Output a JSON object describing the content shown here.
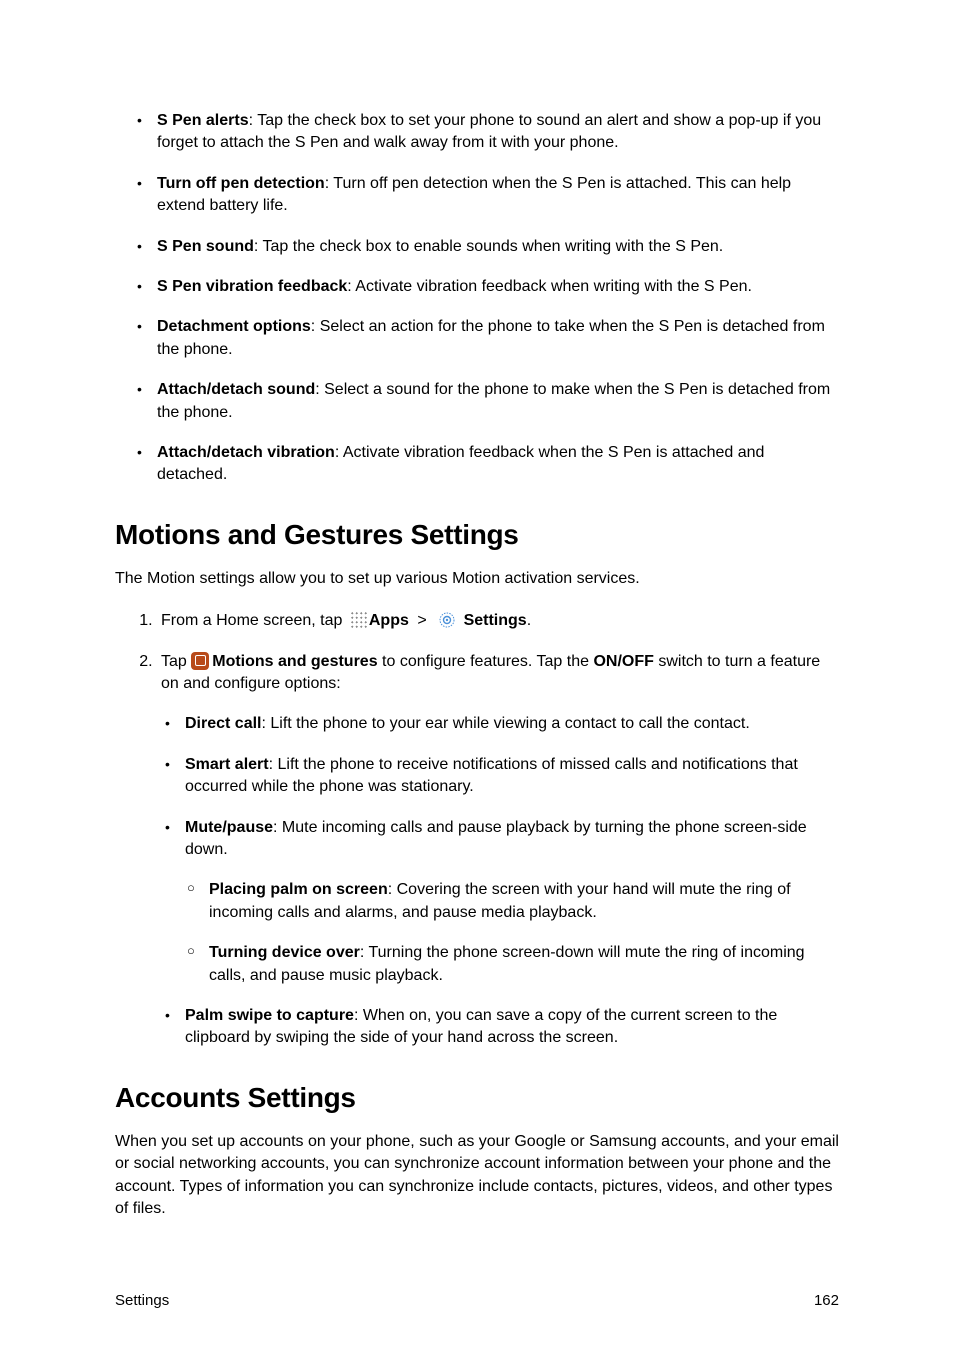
{
  "spen": {
    "items": [
      {
        "label": "S Pen alerts",
        "text": ": Tap the check box to set your phone to sound an alert and show a pop-up if you forget to attach the S Pen and walk away from it with your phone."
      },
      {
        "label": "Turn off pen detection",
        "text": ": Turn off pen detection when the S Pen is attached. This can help extend battery life."
      },
      {
        "label": "S Pen sound",
        "text": ": Tap the check box to enable sounds when writing with the S Pen."
      },
      {
        "label": "S Pen vibration feedback",
        "text": ": Activate vibration feedback when writing with the S Pen."
      },
      {
        "label": "Detachment options",
        "text": ": Select an action for the phone to take when the S Pen is detached from the phone."
      },
      {
        "label": "Attach/detach sound",
        "text": ": Select a sound for the phone to make when the S Pen is detached from the phone."
      },
      {
        "label": "Attach/detach vibration",
        "text": ": Activate vibration feedback when the S Pen is attached and detached."
      }
    ]
  },
  "motions": {
    "heading": "Motions and Gestures Settings",
    "intro": "The Motion settings allow you to set up various Motion activation services.",
    "step1_pre": "From a Home screen, tap",
    "step1_apps": "Apps",
    "step1_gt": ">",
    "step1_settings": "Settings",
    "step1_period": ".",
    "step2_pre": "Tap",
    "step2_mg": "Motions and gestures",
    "step2_mid": " to configure features. Tap the ",
    "step2_onoff": "ON/OFF",
    "step2_tail": " switch to turn a feature on and configure options:",
    "feats": [
      {
        "label": "Direct call",
        "text": ": Lift the phone to your ear while viewing a contact to call the contact."
      },
      {
        "label": "Smart alert",
        "text": ": Lift the phone to receive notifications of missed calls and notifications that occurred while the phone was stationary."
      },
      {
        "label": "Mute/pause",
        "text": ": Mute incoming calls and pause playback by turning the phone screen-side down."
      },
      {
        "label": "Palm swipe to capture",
        "text": ": When on, you can save a copy of the current screen to the clipboard by swiping the side of your hand across the screen."
      }
    ],
    "mute_subs": [
      {
        "label": "Placing palm on screen",
        "text": ": Covering the screen with your hand will mute the ring of incoming calls and alarms, and pause media playback."
      },
      {
        "label": "Turning device over",
        "text": ": Turning the phone screen-down will mute the ring of incoming calls, and pause music playback."
      }
    ]
  },
  "accounts": {
    "heading": "Accounts Settings",
    "intro": "When you set up accounts on your phone, such as your Google or Samsung accounts, and your email or social networking accounts, you can synchronize account information between your phone and the account. Types of information you can synchronize include contacts, pictures, videos, and other types of files."
  },
  "footer": {
    "section": "Settings",
    "page": "162"
  }
}
